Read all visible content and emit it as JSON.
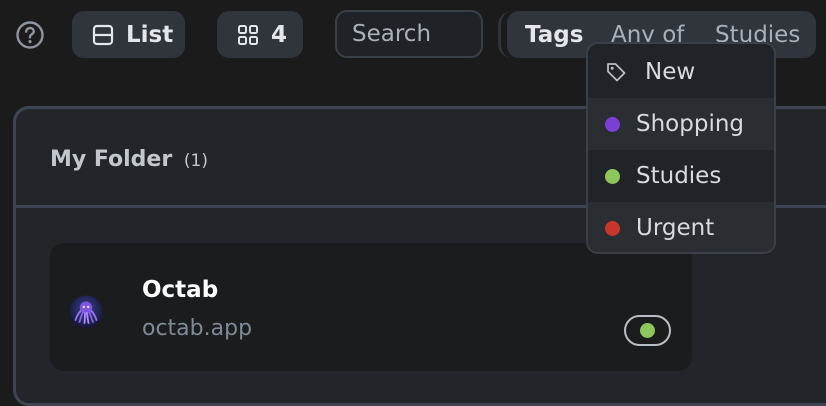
{
  "toolbar": {
    "help_icon": "question-circle-icon",
    "list_button": {
      "icon": "list-layout-icon",
      "label": "List"
    },
    "grid_button": {
      "icon": "grid-icon",
      "label": "4"
    },
    "search": {
      "placeholder": "Search",
      "value": ""
    },
    "tags_filter": {
      "label": "Tags",
      "mode": "Any of",
      "value": "Studies"
    }
  },
  "folder": {
    "title": "My Folder",
    "count": "(1)",
    "items": [
      {
        "title": "Octab",
        "url": "octab.app",
        "icon": "octopus-icon",
        "tag_color": "#8dc65a"
      }
    ]
  },
  "tag_menu": {
    "new_label": "New",
    "items": [
      {
        "label": "Shopping",
        "color": "#7b3fd3"
      },
      {
        "label": "Studies",
        "color": "#8dc65a"
      },
      {
        "label": "Urgent",
        "color": "#c8352b"
      }
    ]
  }
}
